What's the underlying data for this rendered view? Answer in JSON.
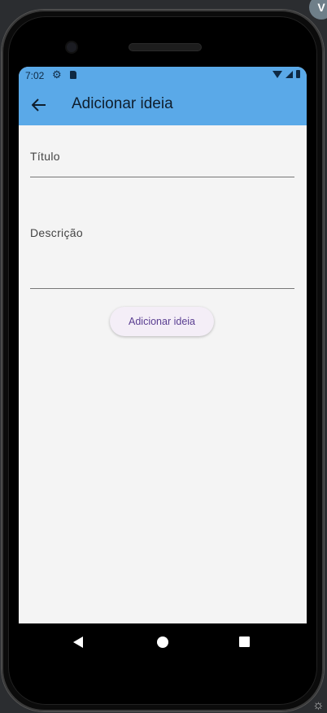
{
  "corner_avatar": "V",
  "status_bar": {
    "time": "7:02"
  },
  "app_bar": {
    "title": "Adicionar ideia",
    "back_icon": "arrow-left-icon"
  },
  "form": {
    "title_label": "Título",
    "description_label": "Descrição",
    "submit_label": "Adicionar ideia"
  },
  "colors": {
    "app_bar": "#5aa9e8",
    "background": "#f4f4f4",
    "button_text": "#5a3e91"
  }
}
